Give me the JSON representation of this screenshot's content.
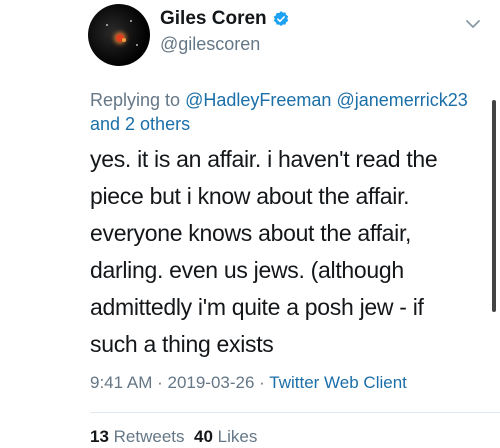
{
  "author": {
    "display_name": "Giles Coren",
    "handle": "@gilescoren",
    "verified": true
  },
  "reply": {
    "prefix": "Replying to",
    "mention_1": "@HadleyFreeman",
    "mention_2": "@janemerrick23",
    "others": "and 2 others"
  },
  "tweet": {
    "lines": [
      "yes. it is an affair. i haven't read the",
      "piece but i know about the affair.",
      "everyone knows about the affair,",
      "darling. even us jews. (although",
      "admittedly i'm quite a posh jew - if",
      "such a thing exists"
    ]
  },
  "meta": {
    "time": "9:41 AM",
    "separator": " · ",
    "date": "2019-03-26",
    "client": "Twitter Web Client"
  },
  "stats": {
    "retweets_count": "13",
    "retweets_label": "Retweets",
    "likes_count": "40",
    "likes_label": "Likes"
  },
  "icons": {
    "verified": "verified-badge-icon",
    "chevron": "chevron-down-icon"
  },
  "colors": {
    "link": "#1b6fa8",
    "secondary_text": "#657786",
    "verified": "#1da1f2"
  }
}
